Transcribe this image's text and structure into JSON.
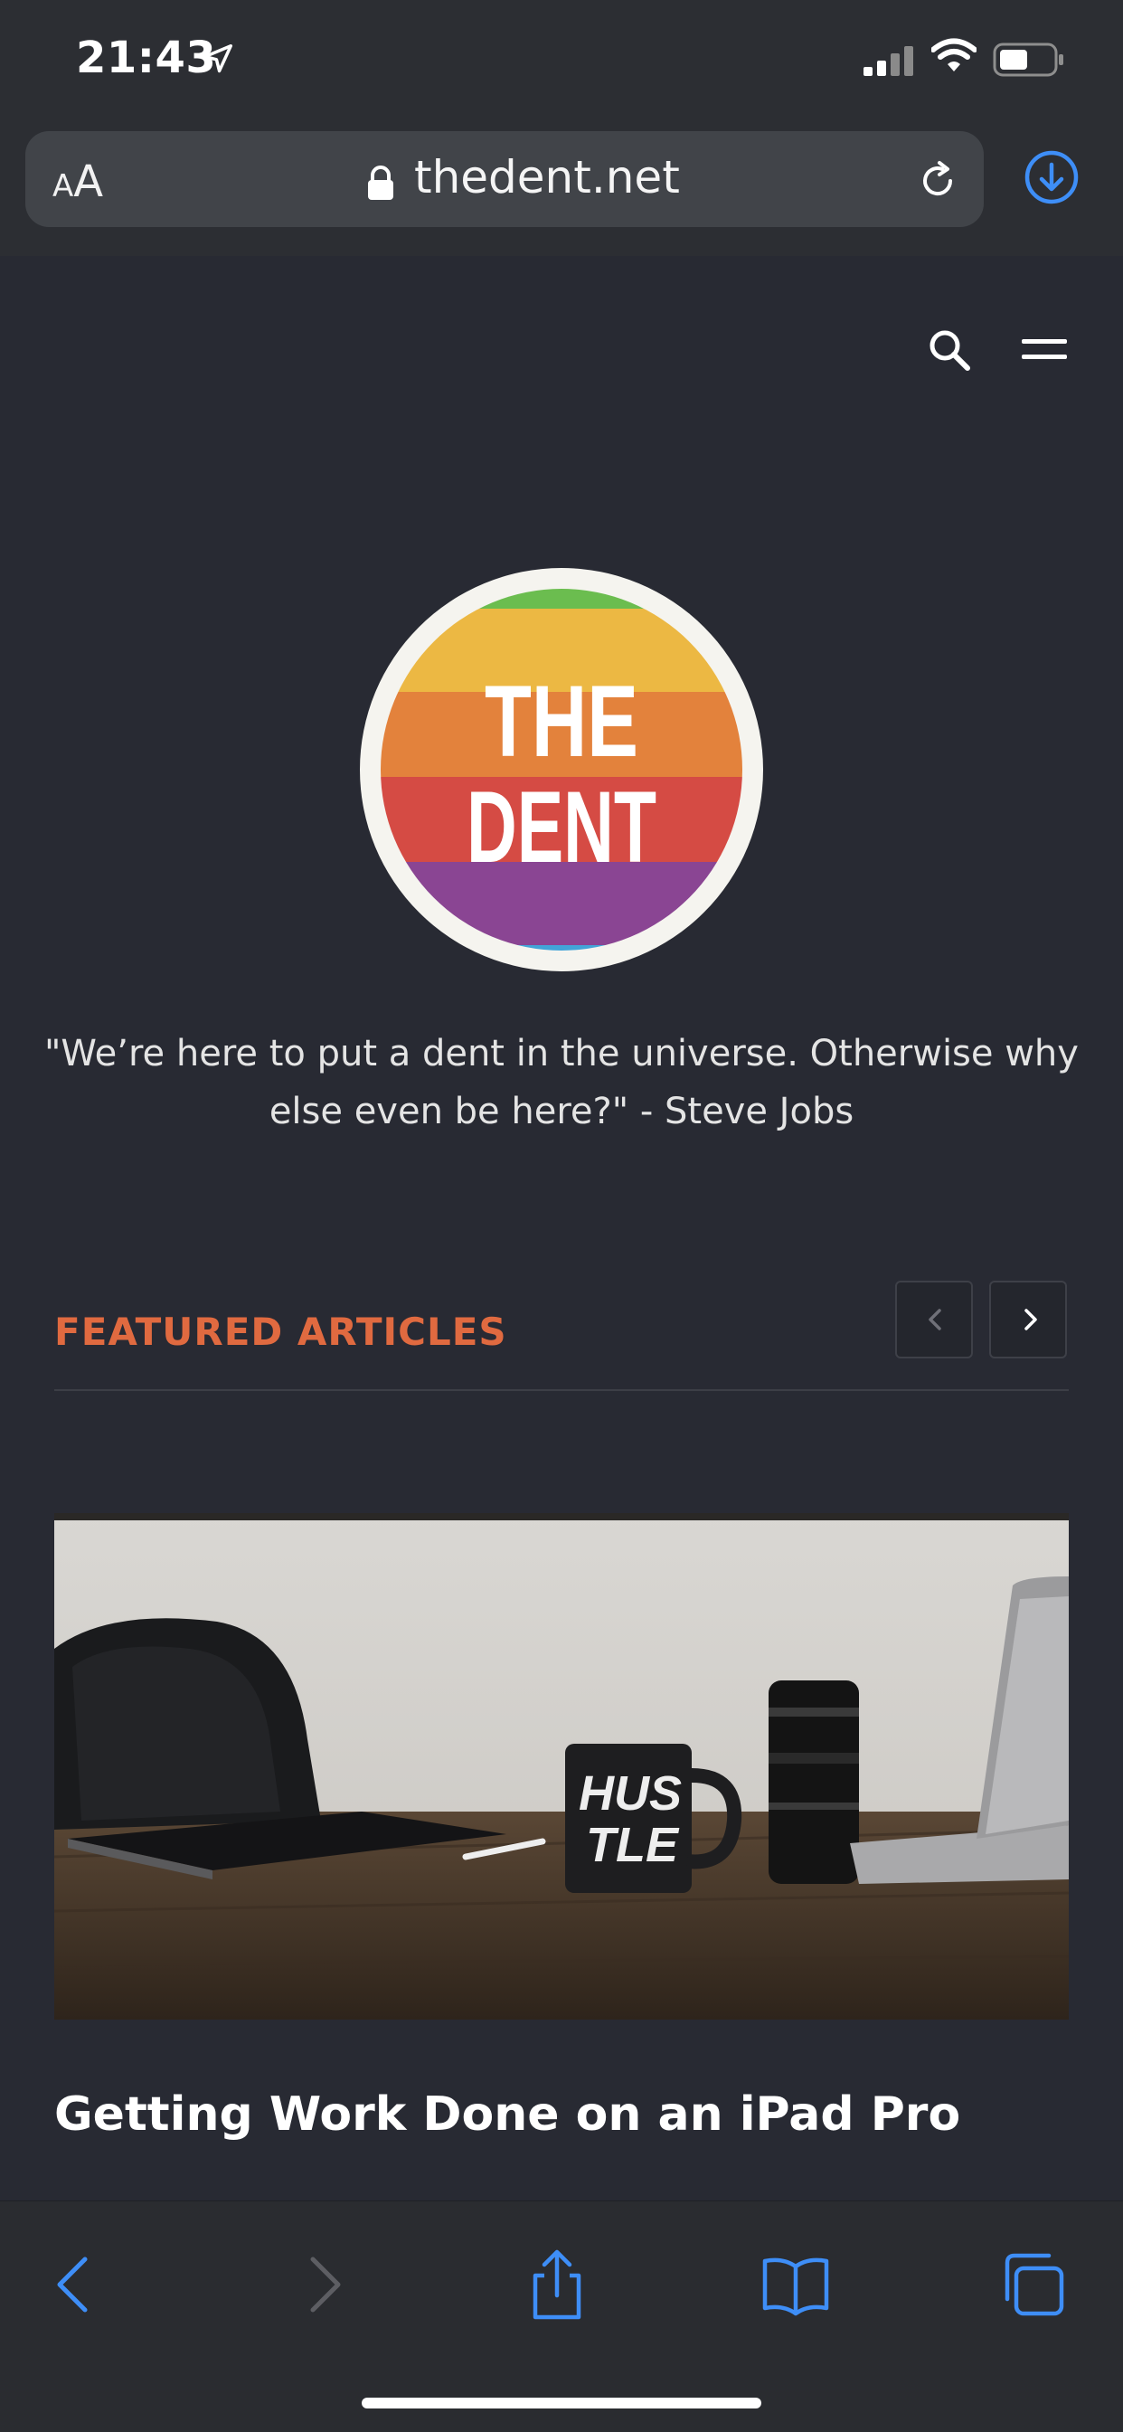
{
  "status": {
    "time": "21:43"
  },
  "browser": {
    "text_size_small": "A",
    "text_size_large": "A",
    "url": "thedent.net"
  },
  "site": {
    "logo_line1": "THE",
    "logo_line2": "DENT",
    "quote": "\"We’re here to put a dent in the universe. Otherwise why else even be here?\" - Steve Jobs",
    "featured": {
      "title": "FEATURED ARTICLES",
      "article_title": "Getting Work Done on an iPad Pro",
      "image_mug_text_1": "HUS",
      "image_mug_text_2": "TLE"
    }
  },
  "colors": {
    "accent": "#e06a40",
    "link_blue": "#3e8ef7",
    "background": "#282a33"
  }
}
